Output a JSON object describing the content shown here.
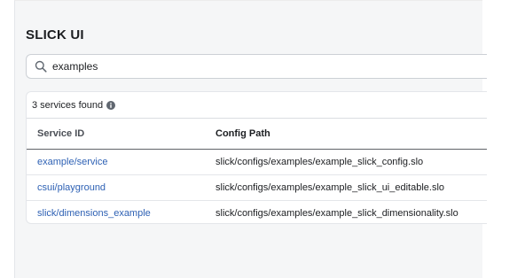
{
  "app": {
    "title": "SLICK UI"
  },
  "search": {
    "value": "examples",
    "placeholder": "",
    "icon": "search-icon"
  },
  "results": {
    "count_text": "3 services found",
    "info_icon": "info-icon"
  },
  "table": {
    "columns": [
      "Service ID",
      "Config Path"
    ],
    "rows": [
      {
        "service_id": "example/service",
        "config_path": "slick/configs/examples/example_slick_config.slo"
      },
      {
        "service_id": "csui/playground",
        "config_path": "slick/configs/examples/example_slick_ui_editable.slo"
      },
      {
        "service_id": "slick/dimensions_example",
        "config_path": "slick/configs/examples/example_slick_dimensionality.slo"
      }
    ]
  },
  "colors": {
    "link": "#2e61b4",
    "text": "#1c1e21",
    "background": "#f5f6f7"
  }
}
